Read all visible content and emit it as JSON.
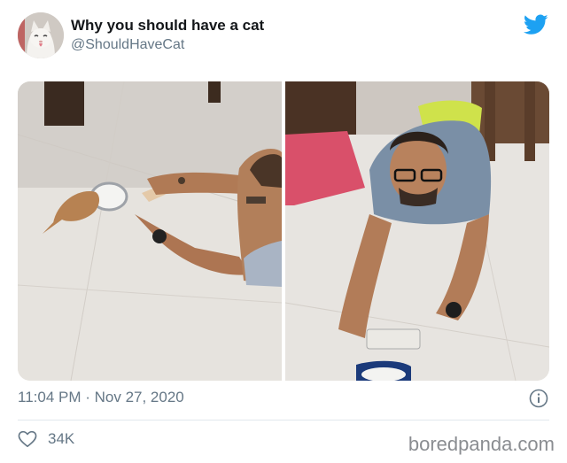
{
  "author": {
    "name": "Why you should have a cat",
    "handle": "@ShouldHaveCat"
  },
  "media": {
    "photos": [
      {
        "subject": "man lying on floor photographing kitten drinking milk"
      },
      {
        "subject": "man lying on floor holding phone, facing camera"
      }
    ]
  },
  "meta": {
    "time": "11:04 PM",
    "separator": " · ",
    "date": "Nov 27, 2020"
  },
  "engagement": {
    "likes": "34K"
  },
  "watermark": "boredpanda.com",
  "colors": {
    "twitter_blue": "#1da1f2",
    "secondary_text": "#657786",
    "primary_text": "#14171a"
  },
  "icons": {
    "brand": "twitter-bird-icon",
    "info": "info-icon",
    "like": "heart-icon"
  }
}
